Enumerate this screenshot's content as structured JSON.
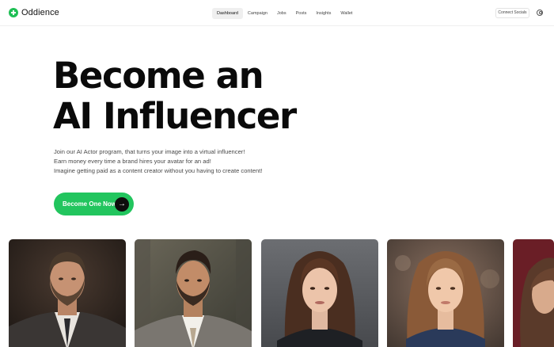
{
  "brand": {
    "name": "Oddience",
    "color": "#1fbf55"
  },
  "nav": {
    "items": [
      {
        "label": "Dashboard",
        "active": true
      },
      {
        "label": "Campaign",
        "active": false
      },
      {
        "label": "Jobs",
        "active": false
      },
      {
        "label": "Posts",
        "active": false
      },
      {
        "label": "Insights",
        "active": false
      },
      {
        "label": "Wallet",
        "active": false
      }
    ]
  },
  "header": {
    "connect_label": "Connect Socials",
    "user_icon": "user-icon"
  },
  "hero": {
    "title_line1": "Become an",
    "title_line2": "AI Influencer",
    "text_line1": "Join our AI Actor program, that turns your image into a virtual influencer!",
    "text_line2": "Earn money every time a brand hires your avatar for an ad!",
    "text_line3": "Imagine getting paid as a content creator without you having to create content!",
    "cta_label": "Become One Now",
    "cta_icon": "arrow-right-icon",
    "accent": "#22c55e"
  },
  "gallery": {
    "cards": [
      {
        "name": "avatar-card-1",
        "subject": "man-bearded-suit"
      },
      {
        "name": "avatar-card-2",
        "subject": "man-bearded-tweed"
      },
      {
        "name": "avatar-card-3",
        "subject": "woman-brunette-dark"
      },
      {
        "name": "avatar-card-4",
        "subject": "woman-brunette-light"
      },
      {
        "name": "avatar-card-5",
        "subject": "partial-portrait"
      }
    ]
  }
}
